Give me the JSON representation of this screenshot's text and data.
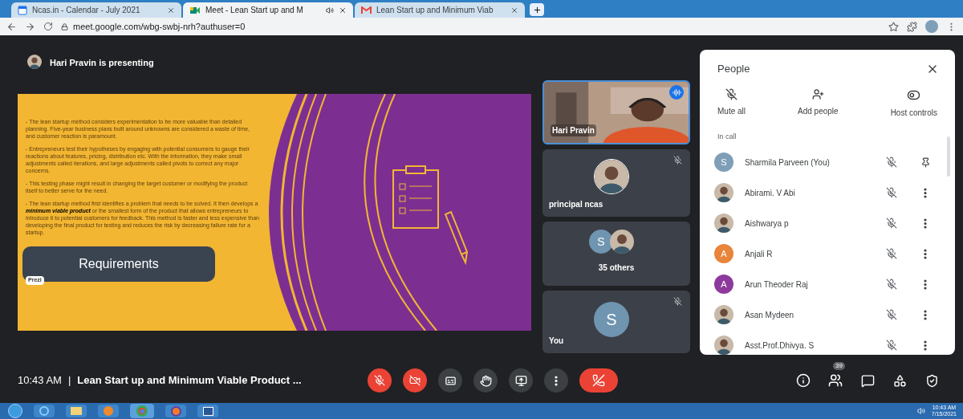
{
  "browser": {
    "tabs": [
      {
        "title": "Ncas.in - Calendar - July 2021",
        "audio": false,
        "selected": false
      },
      {
        "title": "Meet - Lean Start up and M",
        "audio": true,
        "selected": true
      },
      {
        "title": "Lean Start up and Minimum Viab",
        "audio": false,
        "selected": false
      }
    ],
    "url": "meet.google.com/wbg-swbj-nrh?authuser=0"
  },
  "presenting": "Hari Pravin is presenting",
  "slide": {
    "paragraphs": [
      "- The lean startup method considers experimentation to be more valuable than detailed planning. Five-year business plans built around unknowns are considered a waste of time, and customer reaction is paramount.",
      "- Entrepreneurs test their hypotheses by engaging with potential consumers to gauge their reactions about features, pricing, distribution etc. With the information, they make small adjustments called iterations, and large adjustments called pivots to correct any major concerns.",
      "- This testing phase might result in changing the target customer or modifying the product itself to better serve for the need.",
      "- The lean startup method first identifies a problem that needs to be solved. It then develops a **minimum viable product** or the smallest form of the product that allows entrepreneurs to introduce it to potential customers for feedback. This method is faster and less expensive than developing the final product for testing and reduces the risk by decreasing failure rate for a startup."
    ],
    "heading": "Requirements",
    "badge": "Prezi"
  },
  "tiles": [
    {
      "kind": "video",
      "name": "Hari Pravin",
      "speaking": true,
      "muted": false
    },
    {
      "name": "principal ncas",
      "speaking": false,
      "muted": true
    },
    {
      "kind": "group",
      "name": "35 others",
      "letter": "S",
      "speaking": false,
      "muted": false
    },
    {
      "kind": "letter",
      "name": "You",
      "letter": "S",
      "speaking": false,
      "muted": true
    }
  ],
  "footer": {
    "time": "10:43 AM",
    "separator": "|",
    "title": "Lean Start up and Minimum Viable Product ..."
  },
  "controls": [
    {
      "kind": "mic",
      "off": true
    },
    {
      "kind": "camera",
      "off": true
    },
    {
      "kind": "captions",
      "off": false
    },
    {
      "kind": "hand",
      "off": false
    },
    {
      "kind": "present",
      "off": false
    },
    {
      "kind": "more",
      "off": false
    },
    {
      "kind": "end"
    }
  ],
  "side_controls": [
    {
      "kind": "info"
    },
    {
      "kind": "people",
      "badge": "39"
    },
    {
      "kind": "chat"
    },
    {
      "kind": "activities"
    },
    {
      "kind": "safety"
    }
  ],
  "people": {
    "title": "People",
    "actions": [
      {
        "kind": "mute",
        "label": "Mute all"
      },
      {
        "kind": "add",
        "label": "Add people"
      },
      {
        "kind": "host",
        "label": "Host controls"
      }
    ],
    "section": "In call",
    "list": [
      {
        "name": "Sharmila Parveen (You)",
        "kind": "letter",
        "letter": "S",
        "color": "#7f9fb8",
        "muted": true,
        "pinnable": true
      },
      {
        "name": "Abirami. V Abi",
        "muted": true,
        "pinnable": false
      },
      {
        "name": "Aishwarya p",
        "muted": true,
        "pinnable": false
      },
      {
        "name": "Anjali R",
        "kind": "letter",
        "letter": "A",
        "color": "#e8853a",
        "muted": true,
        "pinnable": false
      },
      {
        "name": "Arun Theoder Raj",
        "kind": "letter",
        "letter": "A",
        "color": "#8e3a9c",
        "muted": true,
        "pinnable": false
      },
      {
        "name": "Asan Mydeen",
        "muted": true,
        "pinnable": false
      },
      {
        "name": "Asst.Prof.Dhivya. S",
        "muted": true,
        "pinnable": false
      }
    ]
  },
  "taskbar": {
    "apps": [
      {
        "kind": "start"
      },
      {
        "kind": "ie"
      },
      {
        "kind": "folder"
      },
      {
        "kind": "media"
      },
      {
        "kind": "chrome"
      },
      {
        "kind": "firefox"
      },
      {
        "kind": "word"
      }
    ],
    "time": "10:43 AM",
    "date": "7/15/2021"
  }
}
